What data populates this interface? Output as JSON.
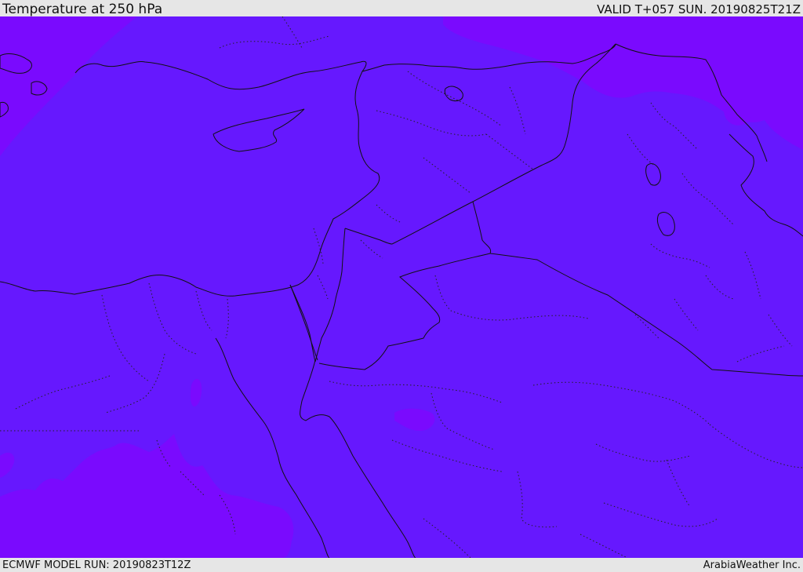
{
  "header": {
    "title": "Temperature at 250 hPa",
    "valid_time": "VALID T+057 SUN. 20190825T21Z"
  },
  "footer": {
    "model_run": "ECMWF MODEL RUN: 20190823T12Z",
    "credit": "ArabiaWeather Inc."
  },
  "colors": {
    "frame_background": "#e6e6e6",
    "field_main": "#6618fe",
    "field_colder_band": "#7a0afe",
    "boundary_line": "#111111"
  }
}
